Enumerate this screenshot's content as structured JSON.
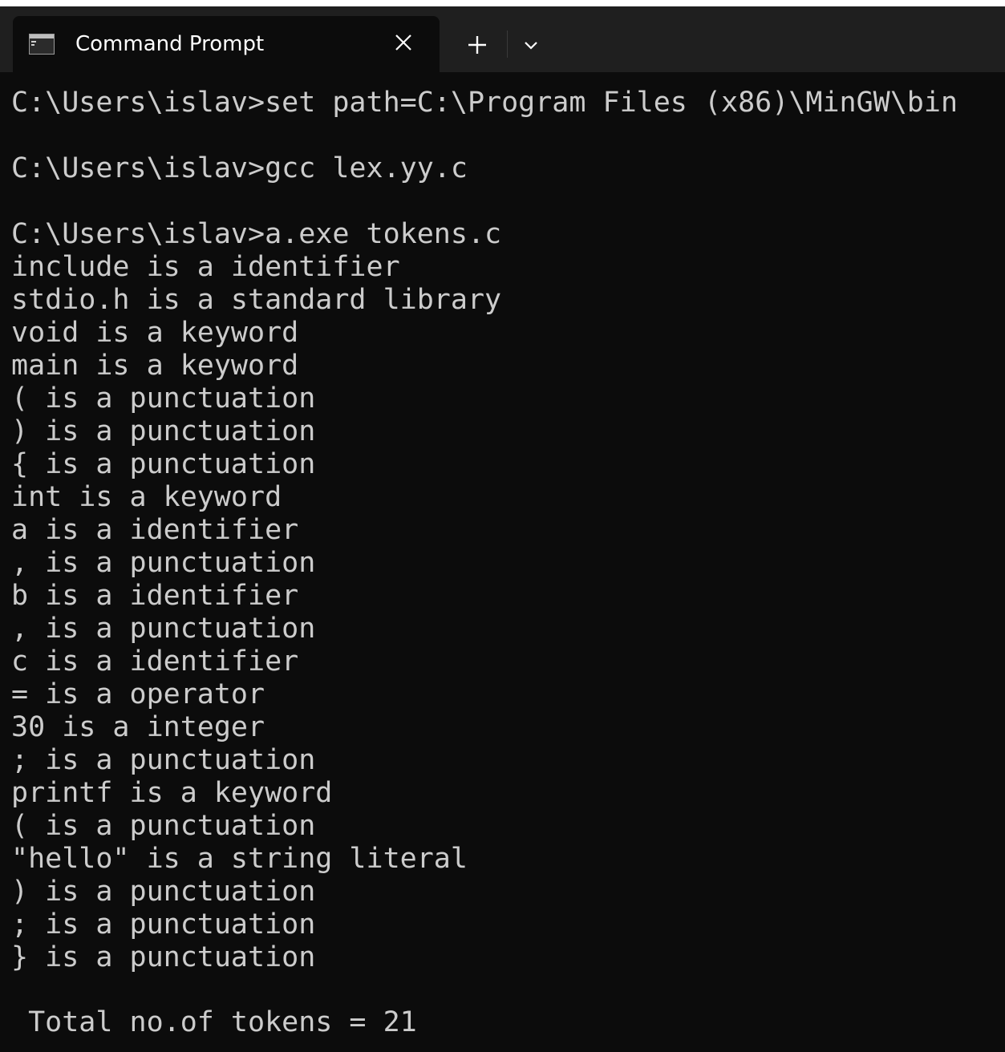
{
  "tab": {
    "title": "Command Prompt"
  },
  "colors": {
    "console_background": "#0c0c0c",
    "console_text": "#cccccc",
    "tabbar_background": "#1f1f1f"
  },
  "icons": {
    "tab_icon": "command-prompt-icon",
    "close": "close-icon",
    "new_tab": "plus-icon",
    "dropdown": "chevron-down-icon"
  },
  "console": {
    "lines": [
      "C:\\Users\\islav>set path=C:\\Program Files (x86)\\MinGW\\bin",
      "C:\\Users\\islav>gcc lex.yy.c",
      "C:\\Users\\islav>a.exe tokens.c",
      "include is a identifier",
      "stdio.h is a standard library",
      "void is a keyword",
      "main is a keyword",
      "( is a punctuation",
      ") is a punctuation",
      "{ is a punctuation",
      "int is a keyword",
      "a is a identifier",
      ", is a punctuation",
      "b is a identifier",
      ", is a punctuation",
      "c is a identifier",
      "= is a operator",
      "30 is a integer",
      "; is a punctuation",
      "printf is a keyword",
      "( is a punctuation",
      "\"hello\" is a string literal",
      ") is a punctuation",
      "; is a punctuation",
      "} is a punctuation",
      " Total no.of tokens = 21"
    ]
  }
}
